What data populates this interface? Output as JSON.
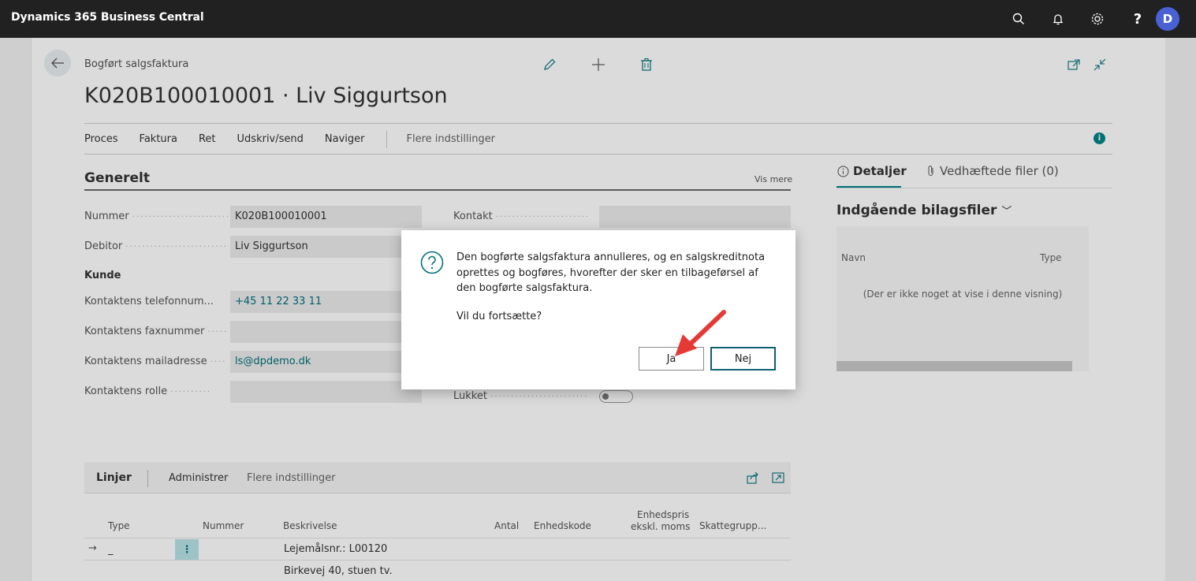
{
  "topbar": {
    "app_title": "Dynamics 365 Business Central",
    "avatar_initial": "D",
    "icons": [
      "search-icon",
      "bell-icon",
      "gear-icon",
      "help-icon"
    ]
  },
  "page": {
    "breadcrumb": "Bogført salgsfaktura",
    "title": "K020B100010001 · Liv Siggurtson",
    "header_actions": [
      "edit-icon",
      "add-icon",
      "delete-icon"
    ],
    "menu": {
      "items": [
        "Proces",
        "Faktura",
        "Ret",
        "Udskriv/send",
        "Naviger"
      ],
      "more": "Flere indstillinger"
    }
  },
  "general": {
    "title": "Generelt",
    "show_more": "Vis mere",
    "fields": [
      {
        "label": "Nummer",
        "value": "K020B100010001"
      },
      {
        "label": "Debitor",
        "value": "Liv Siggurtson"
      }
    ],
    "subheading": "Kunde",
    "contact_fields": [
      {
        "label": "Kontaktens telefonnum...",
        "value": "+45 11 22 33 11"
      },
      {
        "label": "Kontaktens faxnummer",
        "value": ""
      },
      {
        "label": "Kontaktens mailadresse",
        "value": "ls@dpdemo.dk"
      },
      {
        "label": "Kontaktens rolle",
        "value": ""
      }
    ],
    "right_fields": [
      {
        "label": "Kontakt",
        "value": ""
      },
      {
        "label": "Lukket",
        "value": ""
      }
    ]
  },
  "lines": {
    "title": "Linjer",
    "actions": [
      "Administrer",
      "Flere indstillinger"
    ],
    "columns": [
      "Type",
      "Nummer",
      "Beskrivelse",
      "Antal",
      "Enhedskode",
      "Enhedspris",
      "ekskl. moms",
      "Skattegrupp..."
    ],
    "rows": [
      {
        "type": "_",
        "description": "Lejemålsnr.: L00120"
      },
      {
        "type": "",
        "description": "Birkevej 40, stuen tv."
      }
    ]
  },
  "factbox": {
    "tabs": [
      "Detaljer",
      "Vedhæftede filer (0)"
    ],
    "title": "Indgående bilagsfiler",
    "columns": [
      "Navn",
      "Type"
    ],
    "empty": "(Der er ikke noget at vise i denne visning)"
  },
  "dialog": {
    "message": "Den bogførte salgsfaktura annulleres, og en salgskreditnota oprettes og bogføres, hvorefter der sker en tilbageførsel af den bogførte salgsfaktura.",
    "question": "Vil du fortsætte?",
    "yes": "Ja",
    "no": "Nej"
  },
  "colors": {
    "topbar": "#212121",
    "accent": "#008489",
    "avatar": "#4a61d6",
    "annotation_arrow": "#e53935"
  }
}
